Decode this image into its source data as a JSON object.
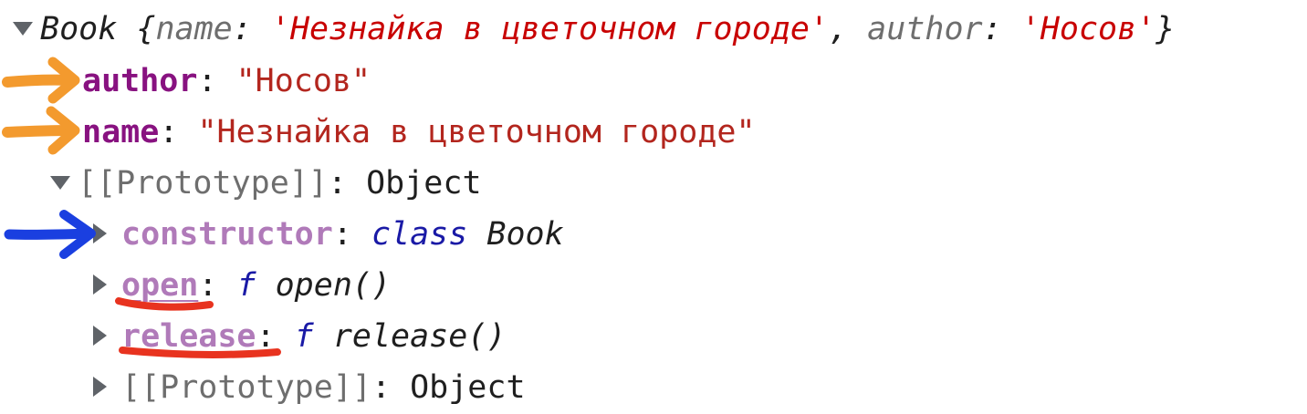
{
  "console": {
    "summary": {
      "class_name": "Book",
      "open_brace": " {",
      "key1": "name",
      "colon": ": ",
      "value1": "'Незнайка в цветочном городе'",
      "comma": ", ",
      "key2": "author",
      "value2": "'Носов'",
      "close_brace": "}"
    },
    "props": [
      {
        "key": "author",
        "value": "\"Носов\""
      },
      {
        "key": "name",
        "value": "\"Незнайка в цветочном городе\""
      }
    ],
    "prototype": {
      "key": "[[Prototype]]",
      "value": "Object",
      "children": [
        {
          "key": "constructor",
          "keyword": "class",
          "value": "Book"
        },
        {
          "key": "open",
          "keyword": "f",
          "value": "open()"
        },
        {
          "key": "release",
          "keyword": "f",
          "value": "release()"
        },
        {
          "key": "[[Prototype]]",
          "value": "Object"
        }
      ]
    },
    "colon": ": "
  },
  "annotations": {
    "orange_arrow_color": "#f39a2e",
    "blue_arrow_color": "#1a3fe0",
    "red_underline_color": "#e8331f"
  }
}
